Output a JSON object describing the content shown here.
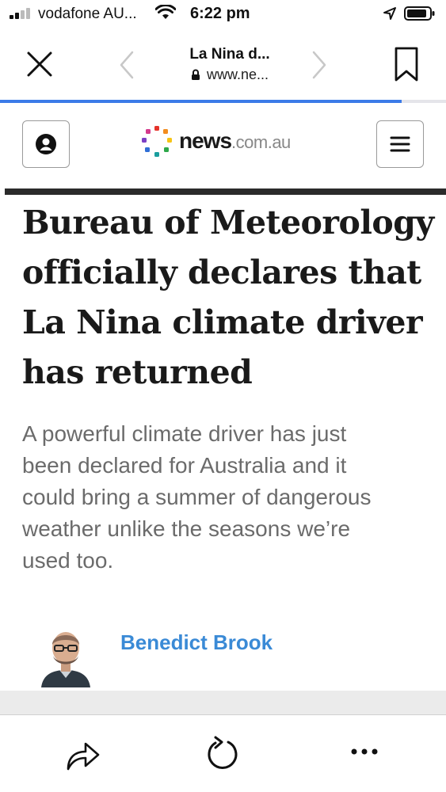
{
  "status_bar": {
    "carrier": "vodafone AU...",
    "time": "6:22 pm"
  },
  "browser": {
    "page_title": "La Nina d...",
    "url": "www.ne...",
    "load_progress": 0.9,
    "icons": {
      "close": "close-icon",
      "back": "chevron-left-icon",
      "forward": "chevron-right-icon",
      "bookmark": "bookmark-icon",
      "lock": "lock-icon"
    }
  },
  "site": {
    "logo_word": "news",
    "logo_domain": ".com.au",
    "icons": {
      "account": "account-icon",
      "menu": "hamburger-menu-icon"
    }
  },
  "article": {
    "headline_lines": [
      "Bureau of Meteorology",
      "officially declares that",
      "La Nina climate driver",
      "has returned"
    ],
    "standfirst_lines": [
      "A powerful climate driver has just",
      "been declared for Australia and it",
      "could bring a summer of dangerous",
      "weather unlike the seasons we’re",
      "used too."
    ],
    "author": "Benedict Brook"
  },
  "toolbar": {
    "icons": {
      "share": "share-icon",
      "reload": "reload-icon",
      "more": "more-icon"
    }
  },
  "colors": {
    "accent_blue": "#3b7be8",
    "author_link": "#3a8ad6",
    "standfirst_grey": "#6b6b6b"
  }
}
